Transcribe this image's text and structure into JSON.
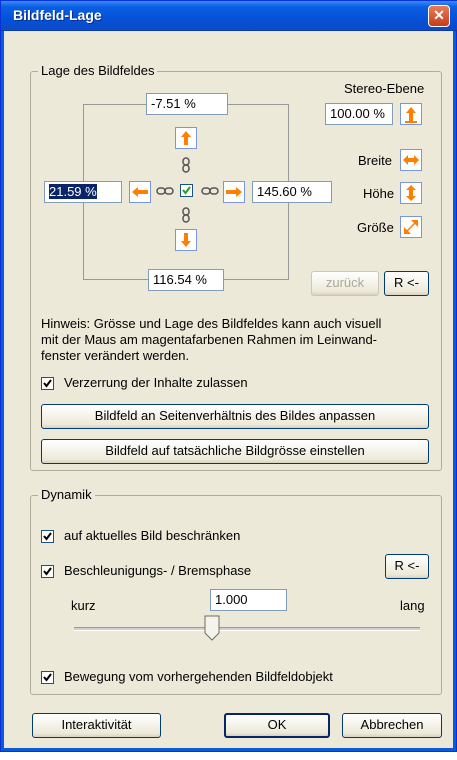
{
  "window": {
    "title": "Bildfeld-Lage"
  },
  "lage": {
    "group_label": "Lage des Bildfeldes",
    "top_value": "-7.51 %",
    "left_value": "21.59 %",
    "right_value": "145.60 %",
    "bottom_value": "116.54 %",
    "stereo_label": "Stereo-Ebene",
    "stereo_value": "100.00 %",
    "breite_label": "Breite",
    "hoehe_label": "Höhe",
    "groesse_label": "Größe",
    "zurueck_label": "zurück",
    "reset_label": "R <-",
    "hint": [
      "Hinweis: Grösse und Lage des Bildfeldes kann auch visuell",
      "mit der Maus am magentafarbenen Rahmen im Leinwand-",
      "fenster verändert werden."
    ],
    "verzerrung_label": "Verzerrung der Inhalte zulassen",
    "verzerrung_checked": true,
    "btn_seiten": "Bildfeld an Seitenverhältnis des Bildes anpassen",
    "btn_tatsaechlich": "Bildfeld auf tatsächliche Bildgrösse einstellen"
  },
  "dynamik": {
    "group_label": "Dynamik",
    "beschraenken_label": "auf aktuelles Bild beschränken",
    "beschraenken_checked": true,
    "beschleunigung_label": "Beschleunigungs- / Bremsphase",
    "beschleunigung_checked": true,
    "reset_label": "R <-",
    "kurz_label": "kurz",
    "lang_label": "lang",
    "value": "1.000",
    "slider_fraction": 0.4,
    "bewegung_label": "Bewegung vom vorhergehenden Bildfeldobjekt",
    "bewegung_checked": true
  },
  "footer": {
    "interaktivitaet": "Interaktivität",
    "ok": "OK",
    "abbrechen": "Abbrechen"
  },
  "colors": {
    "accent": "#ff7f00",
    "title_bar": "#0a5fe2",
    "face": "#ece9d8"
  }
}
